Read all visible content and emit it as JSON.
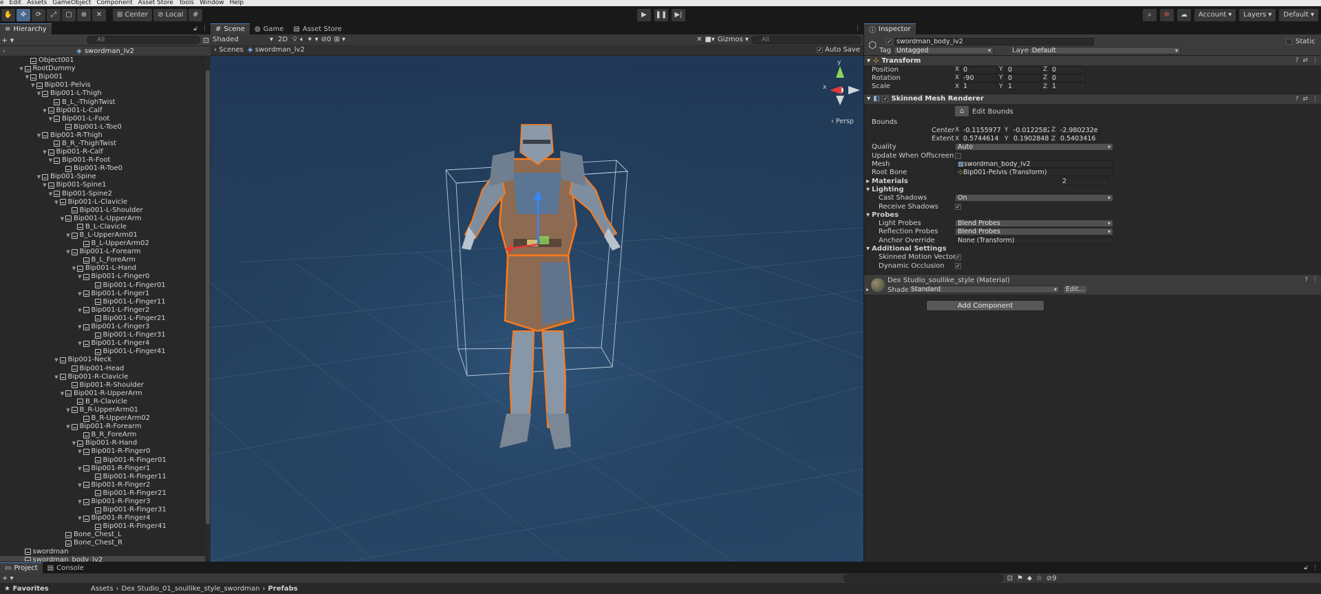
{
  "menu": [
    "e",
    "Edit",
    "Assets",
    "GameObject",
    "Component",
    "Asset Store",
    "Tools",
    "Window",
    "Help"
  ],
  "toolbar": {
    "pivot_label": "Center",
    "space_label": "Local",
    "account_label": "Account",
    "layers_label": "Layers",
    "layout_label": "Default"
  },
  "hierarchy": {
    "tab_label": "Hierarchy",
    "search_placeholder": "All",
    "prefab_name": "swordman_lv2",
    "items": [
      {
        "label": "Object001",
        "depth": 2,
        "arrow": "",
        "selected": false
      },
      {
        "label": "RootDummy",
        "depth": 1,
        "arrow": "▼",
        "selected": false
      },
      {
        "label": "Bip001",
        "depth": 2,
        "arrow": "▼",
        "selected": false
      },
      {
        "label": "Bip001-Pelvis",
        "depth": 3,
        "arrow": "▼",
        "selected": false
      },
      {
        "label": "Bip001-L-Thigh",
        "depth": 4,
        "arrow": "▼",
        "selected": false
      },
      {
        "label": "B_L_-ThighTwist",
        "depth": 6,
        "arrow": "",
        "selected": false
      },
      {
        "label": "Bip001-L-Calf",
        "depth": 5,
        "arrow": "▼",
        "selected": false
      },
      {
        "label": "Bip001-L-Foot",
        "depth": 6,
        "arrow": "▼",
        "selected": false
      },
      {
        "label": "Bip001-L-Toe0",
        "depth": 8,
        "arrow": "",
        "selected": false
      },
      {
        "label": "Bip001-R-Thigh",
        "depth": 4,
        "arrow": "▼",
        "selected": false
      },
      {
        "label": "B_R_-ThighTwist",
        "depth": 6,
        "arrow": "",
        "selected": false
      },
      {
        "label": "Bip001-R-Calf",
        "depth": 5,
        "arrow": "▼",
        "selected": false
      },
      {
        "label": "Bip001-R-Foot",
        "depth": 6,
        "arrow": "▼",
        "selected": false
      },
      {
        "label": "Bip001-R-Toe0",
        "depth": 8,
        "arrow": "",
        "selected": false
      },
      {
        "label": "Bip001-Spine",
        "depth": 4,
        "arrow": "▼",
        "selected": false
      },
      {
        "label": "Bip001-Spine1",
        "depth": 5,
        "arrow": "▼",
        "selected": false
      },
      {
        "label": "Bip001-Spine2",
        "depth": 6,
        "arrow": "▼",
        "selected": false
      },
      {
        "label": "Bip001-L-Clavicle",
        "depth": 7,
        "arrow": "▼",
        "selected": false
      },
      {
        "label": "Bip001-L-Shoulder",
        "depth": 9,
        "arrow": "",
        "selected": false
      },
      {
        "label": "Bip001-L-UpperArm",
        "depth": 8,
        "arrow": "▼",
        "selected": false
      },
      {
        "label": "B_L-Clavicle",
        "depth": 10,
        "arrow": "",
        "selected": false
      },
      {
        "label": "B_L-UpperArm01",
        "depth": 9,
        "arrow": "▼",
        "selected": false
      },
      {
        "label": "B_L-UpperArm02",
        "depth": 11,
        "arrow": "",
        "selected": false
      },
      {
        "label": "Bip001-L-Forearm",
        "depth": 9,
        "arrow": "▼",
        "selected": false
      },
      {
        "label": "B_L_ForeArm",
        "depth": 11,
        "arrow": "",
        "selected": false
      },
      {
        "label": "Bip001-L-Hand",
        "depth": 10,
        "arrow": "▼",
        "selected": false
      },
      {
        "label": "Bip001-L-Finger0",
        "depth": 11,
        "arrow": "▼",
        "selected": false
      },
      {
        "label": "Bip001-L-Finger01",
        "depth": 13,
        "arrow": "",
        "selected": false
      },
      {
        "label": "Bip001-L-Finger1",
        "depth": 11,
        "arrow": "▼",
        "selected": false
      },
      {
        "label": "Bip001-L-Finger11",
        "depth": 13,
        "arrow": "",
        "selected": false
      },
      {
        "label": "Bip001-L-Finger2",
        "depth": 11,
        "arrow": "▼",
        "selected": false
      },
      {
        "label": "Bip001-L-Finger21",
        "depth": 13,
        "arrow": "",
        "selected": false
      },
      {
        "label": "Bip001-L-Finger3",
        "depth": 11,
        "arrow": "▼",
        "selected": false
      },
      {
        "label": "Bip001-L-Finger31",
        "depth": 13,
        "arrow": "",
        "selected": false
      },
      {
        "label": "Bip001-L-Finger4",
        "depth": 11,
        "arrow": "▼",
        "selected": false
      },
      {
        "label": "Bip001-L-Finger41",
        "depth": 13,
        "arrow": "",
        "selected": false
      },
      {
        "label": "Bip001-Neck",
        "depth": 7,
        "arrow": "▼",
        "selected": false
      },
      {
        "label": "Bip001-Head",
        "depth": 9,
        "arrow": "",
        "selected": false
      },
      {
        "label": "Bip001-R-Clavicle",
        "depth": 7,
        "arrow": "▼",
        "selected": false
      },
      {
        "label": "Bip001-R-Shoulder",
        "depth": 9,
        "arrow": "",
        "selected": false
      },
      {
        "label": "Bip001-R-UpperArm",
        "depth": 8,
        "arrow": "▼",
        "selected": false
      },
      {
        "label": "B_R-Clavicle",
        "depth": 10,
        "arrow": "",
        "selected": false
      },
      {
        "label": "B_R-UpperArm01",
        "depth": 9,
        "arrow": "▼",
        "selected": false
      },
      {
        "label": "B_R-UpperArm02",
        "depth": 11,
        "arrow": "",
        "selected": false
      },
      {
        "label": "Bip001-R-Forearm",
        "depth": 9,
        "arrow": "▼",
        "selected": false
      },
      {
        "label": "B_R_ForeArm",
        "depth": 11,
        "arrow": "",
        "selected": false
      },
      {
        "label": "Bip001-R-Hand",
        "depth": 10,
        "arrow": "▼",
        "selected": false
      },
      {
        "label": "Bip001-R-Finger0",
        "depth": 11,
        "arrow": "▼",
        "selected": false
      },
      {
        "label": "Bip001-R-Finger01",
        "depth": 13,
        "arrow": "",
        "selected": false
      },
      {
        "label": "Bip001-R-Finger1",
        "depth": 11,
        "arrow": "▼",
        "selected": false
      },
      {
        "label": "Bip001-R-Finger11",
        "depth": 13,
        "arrow": "",
        "selected": false
      },
      {
        "label": "Bip001-R-Finger2",
        "depth": 11,
        "arrow": "▼",
        "selected": false
      },
      {
        "label": "Bip001-R-Finger21",
        "depth": 13,
        "arrow": "",
        "selected": false
      },
      {
        "label": "Bip001-R-Finger3",
        "depth": 11,
        "arrow": "▼",
        "selected": false
      },
      {
        "label": "Bip001-R-Finger31",
        "depth": 13,
        "arrow": "",
        "selected": false
      },
      {
        "label": "Bip001-R-Finger4",
        "depth": 11,
        "arrow": "▼",
        "selected": false
      },
      {
        "label": "Bip001-R-Finger41",
        "depth": 13,
        "arrow": "",
        "selected": false
      },
      {
        "label": "Bone_Chest_L",
        "depth": 8,
        "arrow": "",
        "selected": false
      },
      {
        "label": "Bone_Chest_R",
        "depth": 8,
        "arrow": "",
        "selected": false
      },
      {
        "label": "swordman",
        "depth": 1,
        "arrow": "",
        "selected": false
      },
      {
        "label": "swordman_body_lv2",
        "depth": 1,
        "arrow": "",
        "selected": true
      }
    ]
  },
  "scene": {
    "tabs": [
      "Scene",
      "Game",
      "Asset Store"
    ],
    "shading_mode": "Shaded",
    "mode_2d": "2D",
    "hidden_count": "0",
    "gizmos_label": "Gizmos",
    "search_placeholder": "All",
    "breadcrumb_root": "Scenes",
    "breadcrumb_current": "swordman_lv2",
    "auto_save_label": "Auto Save",
    "auto_save_checked": true,
    "projection_label": "Persp",
    "axis_x": "x",
    "axis_y": "y"
  },
  "inspector": {
    "tab_label": "Inspector",
    "object_name": "swordman_body_lv2",
    "static_label": "Static",
    "tag_label": "Tag",
    "tag_value": "Untagged",
    "layer_label": "Layer",
    "layer_value": "Default",
    "transform": {
      "title": "Transform",
      "position_label": "Position",
      "rotation_label": "Rotation",
      "scale_label": "Scale",
      "position": {
        "x": "0",
        "y": "0",
        "z": "0"
      },
      "rotation": {
        "x": "-90",
        "y": "0",
        "z": "0"
      },
      "scale": {
        "x": "1",
        "y": "1",
        "z": "1"
      }
    },
    "smr": {
      "title": "Skinned Mesh Renderer",
      "edit_bounds_label": "Edit Bounds",
      "bounds_label": "Bounds",
      "center_label": "Center",
      "extent_label": "Extent",
      "center": {
        "x": "-0.1155977",
        "y": "-0.0122582",
        "z": "-2.980232e"
      },
      "extent": {
        "x": "0.5744614",
        "y": "0.1902848",
        "z": "0.5403416"
      },
      "quality_label": "Quality",
      "quality_value": "Auto",
      "update_offscreen_label": "Update When Offscreen",
      "mesh_label": "Mesh",
      "mesh_value": "swordman_body_lv2",
      "root_bone_label": "Root Bone",
      "root_bone_value": "Bip001-Pelvis (Transform)",
      "materials_label": "Materials",
      "materials_count": "2",
      "lighting_label": "Lighting",
      "cast_shadows_label": "Cast Shadows",
      "cast_shadows_value": "On",
      "receive_shadows_label": "Receive Shadows",
      "probes_label": "Probes",
      "light_probes_label": "Light Probes",
      "light_probes_value": "Blend Probes",
      "reflection_probes_label": "Reflection Probes",
      "reflection_probes_value": "Blend Probes",
      "anchor_override_label": "Anchor Override",
      "anchor_override_value": "None (Transform)",
      "additional_settings_label": "Additional Settings",
      "skinned_motion_label": "Skinned Motion Vectors",
      "dynamic_occlusion_label": "Dynamic Occlusion"
    },
    "material": {
      "name": "Dex Studio_soullike_style (Material)",
      "shader_label": "Shader",
      "shader_value": "Standard",
      "edit_label": "Edit..."
    },
    "add_component_label": "Add Component"
  },
  "bottom": {
    "tabs": [
      "Project",
      "Console"
    ],
    "favorites_label": "Favorites",
    "breadcrumb": [
      "Assets",
      "Dex Studio_01_soullike_style_swordman",
      "Prefabs"
    ],
    "hidden_count": "9"
  },
  "colors": {
    "selection_outline": "#ff7a1a",
    "viewport_bg": "#24415f",
    "accent_blue": "#4e84c4"
  }
}
